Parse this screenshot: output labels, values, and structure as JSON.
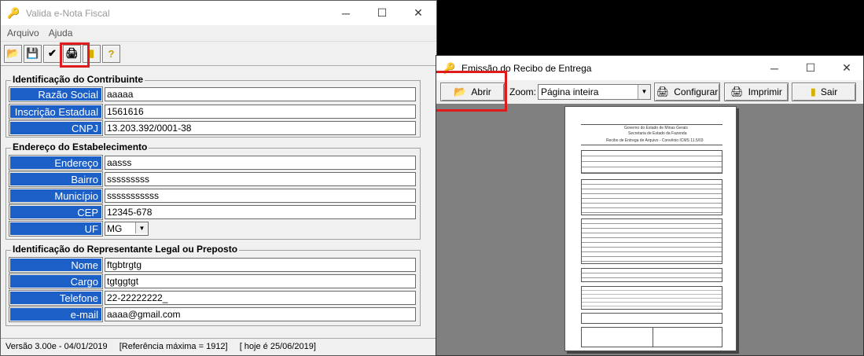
{
  "left_window": {
    "title": "Valida e-Nota Fiscal",
    "menu": [
      "Arquivo",
      "Ajuda"
    ],
    "contribuinte": {
      "title": "Identificação do Contribuinte",
      "fields": [
        {
          "label": "Razão Social",
          "value": "aaaaa"
        },
        {
          "label": "Inscrição Estadual",
          "value": "1561616"
        },
        {
          "label": "CNPJ",
          "value": "13.203.392/0001-38"
        }
      ]
    },
    "endereco": {
      "title": "Endereço do Estabelecimento",
      "fields": [
        {
          "label": "Endereço",
          "value": "aasss"
        },
        {
          "label": "Bairro",
          "value": "sssssssss"
        },
        {
          "label": "Município",
          "value": "sssssssssss"
        },
        {
          "label": "CEP",
          "value": "12345-678"
        },
        {
          "label": "UF",
          "value": "MG"
        }
      ]
    },
    "representante": {
      "title": "Identificação do Representante Legal ou Preposto",
      "fields": [
        {
          "label": "Nome",
          "value": "ftgbtrgtg"
        },
        {
          "label": "Cargo",
          "value": "tgtggtgt"
        },
        {
          "label": "Telefone",
          "value": "22-22222222_"
        },
        {
          "label": "e-mail",
          "value": "aaaa@gmail.com"
        }
      ]
    },
    "status": {
      "versao": "Versão 3.00e - 04/01/2019",
      "referencia": "[Referência máxima = 1912]",
      "hoje": "[ hoje é 25/06/2019]"
    }
  },
  "right_window": {
    "title": "Emissão do Recibo de Entrega",
    "abrir_label": "Abrir",
    "zoom_label": "Zoom:",
    "zoom_value": "Página inteira",
    "configurar_label": "Configurar",
    "imprimir_label": "Imprimir",
    "sair_label": "Sair"
  },
  "document": {
    "header1": "Governo do Estado de Minas Gerais",
    "header2": "Secretaria de Estado da Fazenda",
    "header3": "Recibo de Entrega de Arquivo - Convênio ICMS 11.5/03"
  },
  "colors": {
    "label_bg": "#1c5fc6",
    "highlight": "#e01b1b"
  }
}
